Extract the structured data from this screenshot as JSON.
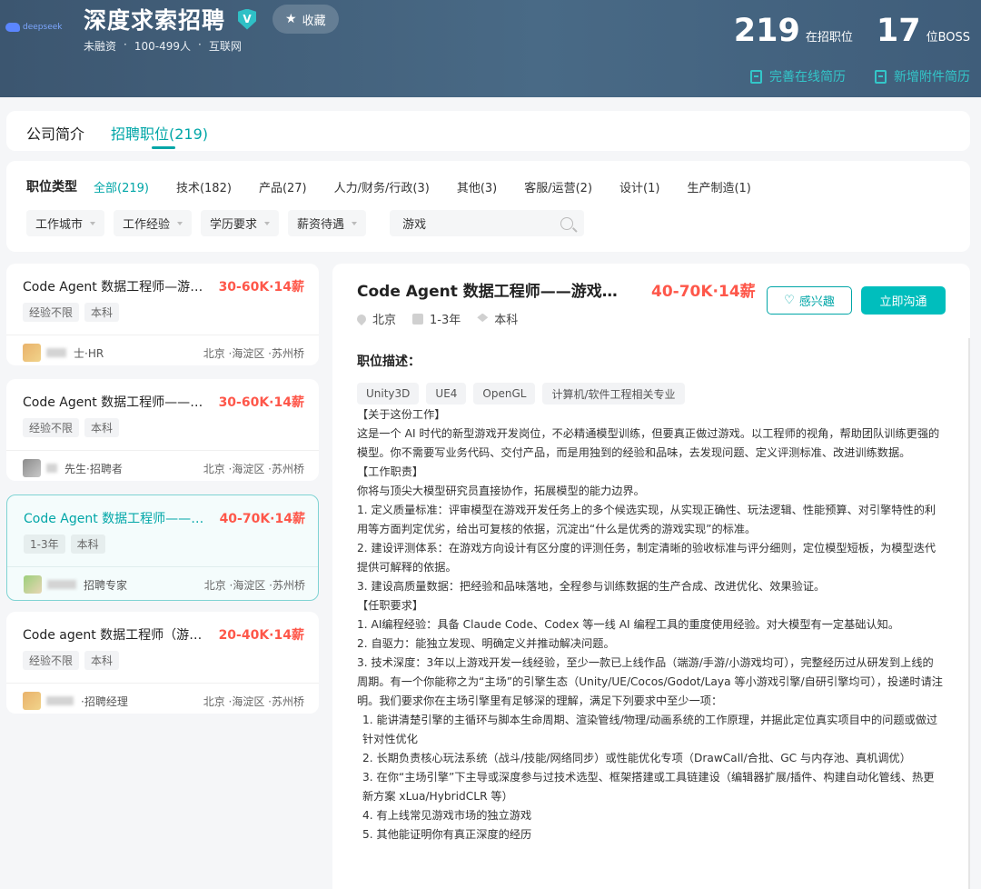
{
  "header": {
    "logo_text": "deepseek",
    "company_name": "深度求索招聘",
    "verified_badge": "V",
    "favorite_label": "收藏",
    "meta": [
      "未融资",
      "·",
      "100-499人",
      "·",
      "互联网"
    ],
    "stats": [
      {
        "number": "219",
        "label": "在招职位"
      },
      {
        "number": "17",
        "label": "位BOSS"
      }
    ],
    "links": [
      "完善在线简历",
      "新增附件简历"
    ]
  },
  "tabs": [
    {
      "label": "公司简介",
      "active": false
    },
    {
      "label": "招聘职位(219)",
      "active": true
    }
  ],
  "filters": {
    "title": "职位类型",
    "types": [
      "全部(219)",
      "技术(182)",
      "产品(27)",
      "人力/财务/行政(3)",
      "其他(3)",
      "客服/运营(2)",
      "设计(1)",
      "生产制造(1)"
    ],
    "dropdowns": [
      "工作城市",
      "工作经验",
      "学历要求",
      "薪资待遇"
    ],
    "search_value": "游戏"
  },
  "jobs": [
    {
      "title": "Code Agent 数据工程师—游戏…",
      "salary": "30-60K·14薪",
      "tags": [
        "经验不限",
        "本科"
      ],
      "recruiter": "士·HR",
      "location": "北京 ·海淀区 ·苏州桥"
    },
    {
      "title": "Code Agent 数据工程师——游…",
      "salary": "30-60K·14薪",
      "tags": [
        "经验不限",
        "本科"
      ],
      "recruiter": "先生·招聘者",
      "location": "北京 ·海淀区 ·苏州桥"
    },
    {
      "title": "Code Agent 数据工程师——游…",
      "salary": "40-70K·14薪",
      "tags": [
        "1-3年",
        "本科"
      ],
      "recruiter": "招聘专家",
      "location": "北京 ·海淀区 ·苏州桥"
    },
    {
      "title": "Code agent 数据工程师（游戏…",
      "salary": "20-40K·14薪",
      "tags": [
        "经验不限",
        "本科"
      ],
      "recruiter": "·招聘经理",
      "location": "北京 ·海淀区 ·苏州桥"
    }
  ],
  "detail": {
    "title": "Code Agent 数据工程师——游戏开…",
    "salary": "40-70K·14薪",
    "interest_label": "感兴趣",
    "chat_label": "立即沟通",
    "meta": [
      "北京",
      "1-3年",
      "本科"
    ],
    "section_title": "职位描述：",
    "skills": [
      "Unity3D",
      "UE4",
      "OpenGL",
      "计算机/软件工程相关专业"
    ],
    "paragraphs": [
      "【关于这份工作】",
      "这是一个 AI 时代的新型游戏开发岗位，不必精通模型训练，但要真正做过游戏。以工程师的视角，帮助团队训练更强的模型。你不需要写业务代码、交付产品，而是用独到的经验和品味，去发现问题、定义评测标准、改进训练数据。",
      "【工作职责】",
      "你将与顶尖大模型研究员直接协作，拓展模型的能力边界。",
      "1. 定义质量标准：评审模型在游戏开发任务上的多个候选实现，从实现正确性、玩法逻辑、性能预算、对引擎特性的利用等方面判定优劣，给出可复核的依据，沉淀出“什么是优秀的游戏实现”的标准。",
      "2. 建设评测体系：在游戏方向设计有区分度的评测任务，制定清晰的验收标准与评分细则，定位模型短板，为模型迭代提供可解释的依据。",
      "3. 建设高质量数据：把经验和品味落地，全程参与训练数据的生产合成、改进优化、效果验证。",
      "【任职要求】",
      "1. AI编程经验：具备 Claude Code、Codex 等一线 AI 编程工具的重度使用经验。对大模型有一定基础认知。",
      "2. 自驱力：能独立发现、明确定义并推动解决问题。",
      "3. 技术深度：3年以上游戏开发一线经验，至少一款已上线作品（端游/手游/小游戏均可），完整经历过从研发到上线的周期。有一个你能称之为“主场”的引擎生态（Unity/UE/Cocos/Godot/Laya 等小游戏引擎/自研引擎均可），投递时请注明。我们要求你在主场引擎里有足够深的理解，满足下列要求中至少一项：",
      " 1. 能讲清楚引擎的主循环与脚本生命周期、渲染管线/物理/动画系统的工作原理，并据此定位真实项目中的问题或做过针对性优化",
      " 2. 长期负责核心玩法系统（战斗/技能/网络同步）或性能优化专项（DrawCall/合批、GC 与内存池、真机调优）",
      " 3. 在你“主场引擎”下主导或深度参与过技术选型、框架搭建或工具链建设（编辑器扩展/插件、构建自动化管线、热更新方案 xLua/HybridCLR 等）",
      " 4. 有上线常见游戏市场的独立游戏",
      " 5. 其他能证明你有真正深度的经历"
    ]
  }
}
